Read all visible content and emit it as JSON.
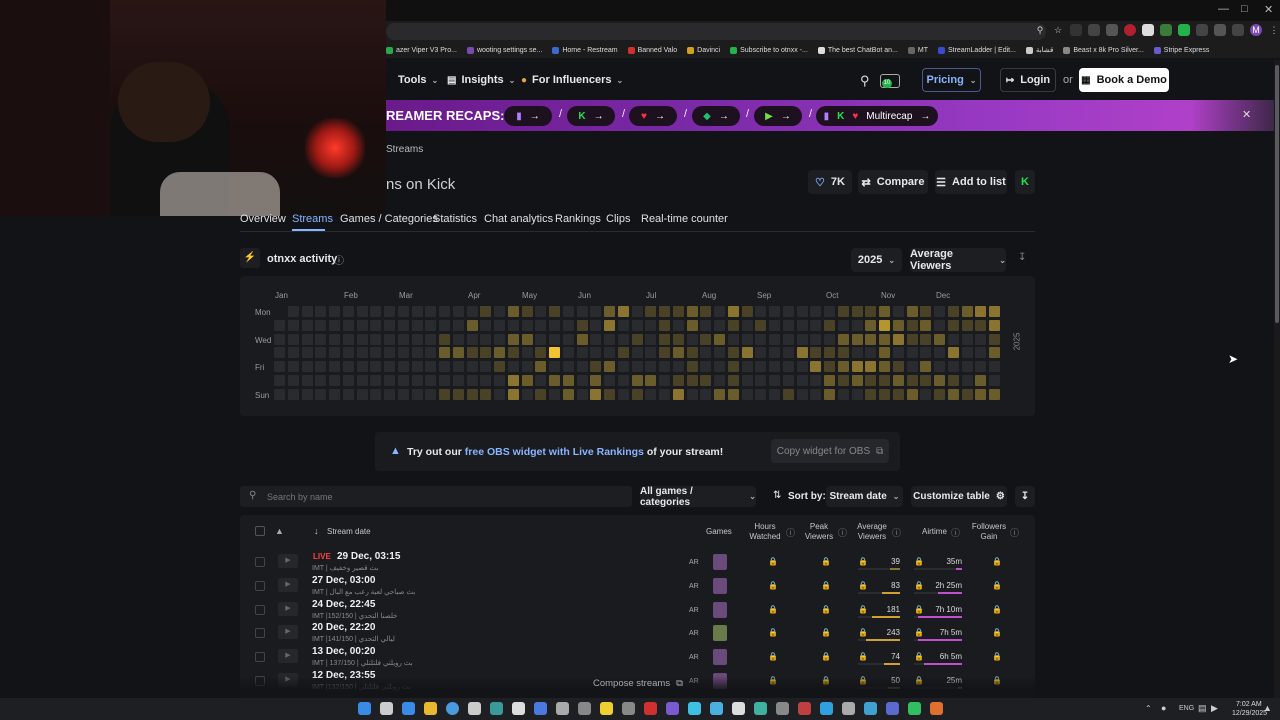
{
  "browser": {
    "bookmarks": [
      "azer Viper V3 Pro...",
      "wooting settings se...",
      "Home - Restream",
      "Banned Valo",
      "Davinci",
      "Subscribe to otnxx -...",
      "The best ChatBot an...",
      "MT",
      "StreamLadder | Edit...",
      "قشابة",
      "Beast x 8k Pro Silver...",
      "Stripe Express"
    ]
  },
  "nav": {
    "tools": "Tools",
    "insights": "Insights",
    "influencers": "For Influencers",
    "pricing": "Pricing",
    "login": "Login",
    "or": "or",
    "book_demo": "Book a Demo"
  },
  "banner": {
    "title": "REAMER RECAPS:",
    "multirecap": "Multirecap"
  },
  "breadcrumb": "Streams",
  "page_title": "ns on Kick",
  "actions": {
    "likes": "7K",
    "compare": "Compare",
    "add_to_list": "Add to list"
  },
  "tabs": [
    "Overview",
    "Streams",
    "Games / Categories",
    "Statistics",
    "Chat analytics",
    "Rankings",
    "Clips",
    "Real-time counter"
  ],
  "activity": {
    "title": "otnxx activity",
    "year": "2025",
    "metric": "Average Viewers",
    "year_side": "2025",
    "months": [
      "Jan",
      "Feb",
      "Mar",
      "Apr",
      "May",
      "Jun",
      "Jul",
      "Aug",
      "Sep",
      "Oct",
      "Nov",
      "Dec"
    ],
    "days": [
      "Mon",
      "Wed",
      "Fri",
      "Sun"
    ]
  },
  "obs": {
    "pre": "Try out our",
    "link": "free OBS widget with Live Rankings",
    "post": "of your stream!",
    "copy": "Copy widget for OBS"
  },
  "controls": {
    "search_placeholder": "Search by name",
    "games_filter": "All games / categories",
    "sort_label": "Sort by:",
    "sort_value": "Stream date",
    "customize": "Customize table"
  },
  "table": {
    "headers": {
      "stream_date": "Stream date",
      "games": "Games",
      "hours_watched": "Hours Watched",
      "peak_viewers": "Peak Viewers",
      "avg_viewers": "Average Viewers",
      "airtime": "Airtime",
      "followers_gain": "Followers Gain"
    },
    "live_badge": "LIVE",
    "lang": "AR",
    "rows": [
      {
        "date": "29 Dec, 03:15",
        "sub": "IMT | بث قصير وخفيف",
        "avg": "39",
        "airtime": "35m"
      },
      {
        "date": "27 Dec, 03:00",
        "sub": "IMT | بث صباحي لعبة رعب مع البال",
        "avg": "83",
        "airtime": "2h 25m"
      },
      {
        "date": "24 Dec, 22:45",
        "sub": "IMT |152/150 | خلصنا التحدي",
        "avg": "181",
        "airtime": "7h 10m"
      },
      {
        "date": "20 Dec, 22:20",
        "sub": "IMT |141/150 | ليالي التحدي",
        "avg": "243",
        "airtime": "7h 5m"
      },
      {
        "date": "13 Dec, 00:20",
        "sub": "IMT | 137/150 | بث رويلتي فلتلتلي",
        "avg": "74",
        "airtime": "6h 5m"
      },
      {
        "date": "12 Dec, 23:55",
        "sub": "IMT |132/150 | بث رويلتي فلتلتلي",
        "avg": "50",
        "airtime": "25m"
      }
    ],
    "compose": "Compose streams"
  },
  "taskbar": {
    "lang": "ENG",
    "time": "7:02 AM",
    "date": "12/29/2025"
  }
}
